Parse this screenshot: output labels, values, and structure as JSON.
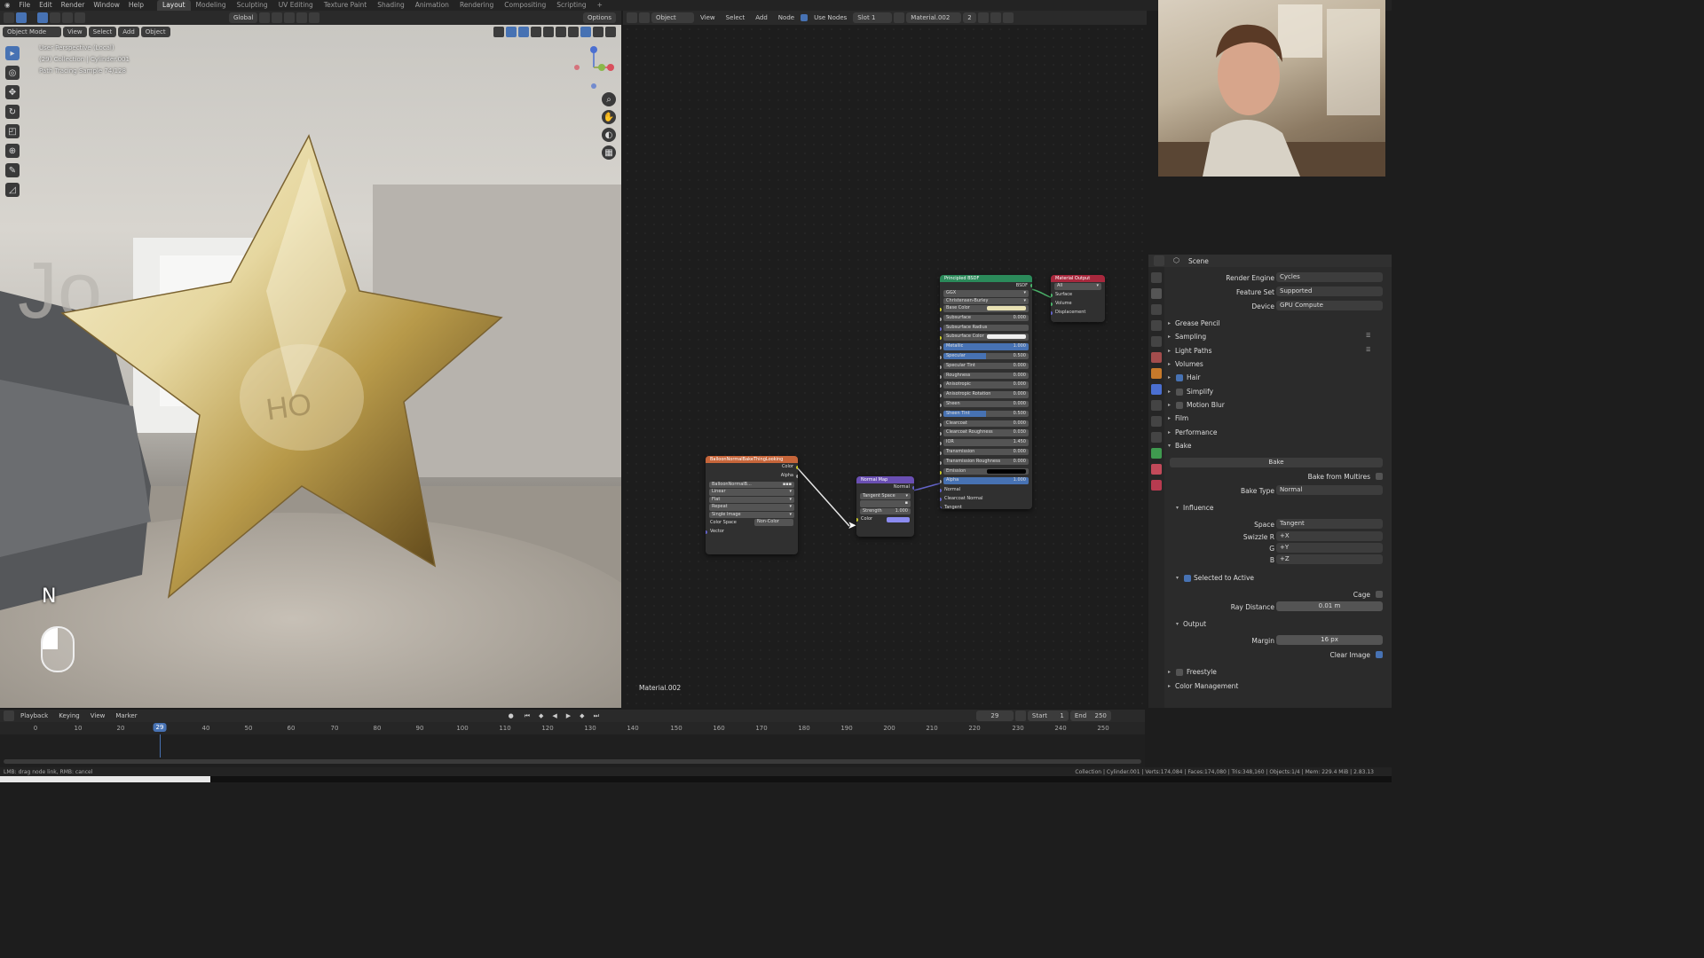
{
  "topbar": {
    "menus": [
      "File",
      "Edit",
      "Render",
      "Window",
      "Help"
    ],
    "workspaces": [
      "Layout",
      "Modeling",
      "Sculpting",
      "UV Editing",
      "Texture Paint",
      "Shading",
      "Animation",
      "Rendering",
      "Compositing",
      "Scripting"
    ],
    "plus": "+"
  },
  "viewport": {
    "mode": "Object Mode",
    "menu": [
      "View",
      "Select",
      "Add",
      "Object"
    ],
    "transform": "Global",
    "options": "Options",
    "overlay_lines": [
      "User Perspective (Local)",
      "(29) Collection | Cylinder.001",
      "Path Tracing Sample 74/128"
    ],
    "key_hint": "N",
    "axes": {
      "x": "X",
      "y": "Y",
      "z": "Z"
    }
  },
  "node_editor": {
    "type": "Object",
    "menu": [
      "View",
      "Select",
      "Add",
      "Node"
    ],
    "use_nodes": "Use Nodes",
    "slot": "Slot 1",
    "material": "Material.002",
    "users": "2",
    "footer_label": "Material.002",
    "image_node": {
      "title": "BalloonNormalBakeThingLooking",
      "outputs": [
        "Color",
        "Alpha"
      ],
      "image": "BalloonNormalB...",
      "fields": [
        "Linear",
        "Flat",
        "Repeat",
        "Single Image"
      ],
      "colorspace_label": "Color Space",
      "colorspace_value": "Non-Color",
      "input": "Vector"
    },
    "normal_map": {
      "title": "Normal Map",
      "output": "Normal",
      "space": "Tangent Space",
      "uv": "",
      "strength_label": "Strength",
      "strength_value": "1.000",
      "color_label": "Color"
    },
    "bsdf": {
      "title": "Principled BSDF",
      "output": "BSDF",
      "distribution": "GGX",
      "subsurface_method": "Christensen-Burley",
      "rows": [
        {
          "label": "Base Color",
          "value": ""
        },
        {
          "label": "Subsurface",
          "value": "0.000"
        },
        {
          "label": "Subsurface Radius",
          "value": ""
        },
        {
          "label": "Subsurface Color",
          "value": ""
        },
        {
          "label": "Metallic",
          "value": "1.000"
        },
        {
          "label": "Specular",
          "value": "0.500"
        },
        {
          "label": "Specular Tint",
          "value": "0.000"
        },
        {
          "label": "Roughness",
          "value": "0.000"
        },
        {
          "label": "Anisotropic",
          "value": "0.000"
        },
        {
          "label": "Anisotropic Rotation",
          "value": "0.000"
        },
        {
          "label": "Sheen",
          "value": "0.000"
        },
        {
          "label": "Sheen Tint",
          "value": "0.500"
        },
        {
          "label": "Clearcoat",
          "value": "0.000"
        },
        {
          "label": "Clearcoat Roughness",
          "value": "0.030"
        },
        {
          "label": "IOR",
          "value": "1.450"
        },
        {
          "label": "Transmission",
          "value": "0.000"
        },
        {
          "label": "Transmission Roughness",
          "value": "0.000"
        },
        {
          "label": "Emission",
          "value": ""
        },
        {
          "label": "Alpha",
          "value": "1.000"
        },
        {
          "label": "Normal",
          "value": ""
        },
        {
          "label": "Clearcoat Normal",
          "value": ""
        },
        {
          "label": "Tangent",
          "value": ""
        }
      ]
    },
    "output_node": {
      "title": "Material Output",
      "target": "All",
      "inputs": [
        "Surface",
        "Volume",
        "Displacement"
      ]
    }
  },
  "properties": {
    "context": "Scene",
    "render_engine_label": "Render Engine",
    "render_engine": "Cycles",
    "feature_set_label": "Feature Set",
    "feature_set": "Supported",
    "device_label": "Device",
    "device": "GPU Compute",
    "panels": [
      "Grease Pencil",
      "Sampling",
      "Light Paths",
      "Volumes",
      "Hair",
      "Simplify",
      "Motion Blur",
      "Film",
      "Performance",
      "Bake"
    ],
    "bake_button": "Bake",
    "bake_from_multires": "Bake from Multires",
    "bake_type_label": "Bake Type",
    "bake_type": "Normal",
    "influence": "Influence",
    "space_label": "Space",
    "space": "Tangent",
    "swizzle_r_label": "Swizzle R",
    "swizzle_r": "+X",
    "g_label": "G",
    "g": "+Y",
    "b_label": "B",
    "b": "+Z",
    "selected_to_active": "Selected to Active",
    "cage_label": "Cage",
    "ray_distance_label": "Ray Distance",
    "ray_distance": "0.01 m",
    "output": "Output",
    "margin_label": "Margin",
    "margin": "16 px",
    "clear_image": "Clear Image",
    "freestyle": "Freestyle",
    "color_management": "Color Management"
  },
  "timeline": {
    "menu": [
      "Playback",
      "Keying",
      "View",
      "Marker"
    ],
    "current_frame": "29",
    "start_label": "Start",
    "start": "1",
    "end_label": "End",
    "end": "250",
    "ticks": [
      "0",
      "10",
      "20",
      "29",
      "40",
      "50",
      "60",
      "70",
      "80",
      "90",
      "100",
      "110",
      "120",
      "130",
      "140",
      "150",
      "160",
      "170",
      "180",
      "190",
      "200",
      "210",
      "220",
      "230",
      "240",
      "250"
    ]
  },
  "status": {
    "left": "LMB: drag node link, RMB: cancel",
    "right": "Collection | Cylinder.001 | Verts:174,084 | Faces:174,080 | Tris:348,160 | Objects:1/4 | Mem: 229.4 MiB | 2.83.13"
  },
  "colors": {
    "accent": "#4772b3",
    "bsdf_header": "#2b8a5a",
    "output_header": "#a8283d",
    "image_header": "#c6653a",
    "normal_header": "#6a4fb3"
  }
}
